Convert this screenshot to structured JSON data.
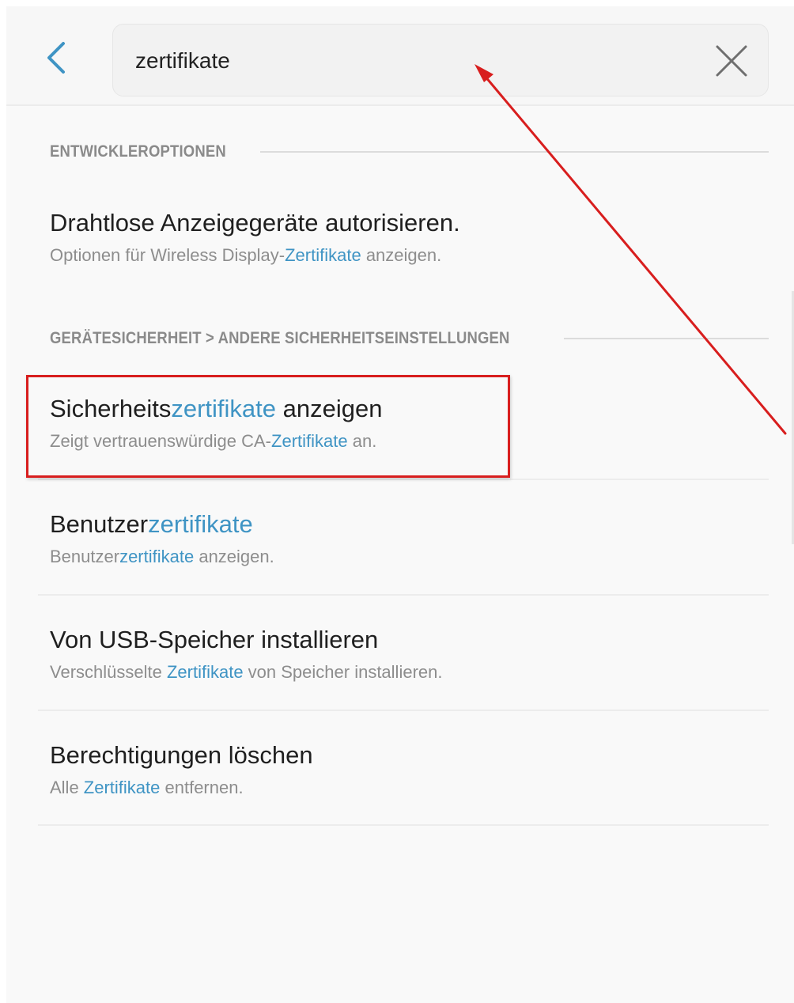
{
  "search": {
    "query": "zertifikate"
  },
  "sections": [
    {
      "header": "ENTWICKLEROPTIONEN",
      "items": [
        {
          "title": [
            "Drahtlose Anzeigegeräte autorisieren."
          ],
          "subtitle": [
            "Optionen für Wireless Display-",
            "Zertifikate",
            " anzeigen."
          ]
        }
      ]
    },
    {
      "header": "GERÄTESICHERHEIT > ANDERE SICHERHEITSEINSTELLUNGEN",
      "items": [
        {
          "title": [
            "Sicherheits",
            "zertifikate",
            " anzeigen"
          ],
          "subtitle": [
            "Zeigt vertrauenswürdige CA-",
            "Zertifikate",
            " an."
          ]
        },
        {
          "title": [
            "Benutzer",
            "zertifikate"
          ],
          "subtitle": [
            "Benutzer",
            "zertifikate",
            " anzeigen."
          ]
        },
        {
          "title": [
            "Von USB-Speicher installieren"
          ],
          "subtitle": [
            "Verschlüsselte ",
            "Zertifikate",
            " von Speicher installieren."
          ]
        },
        {
          "title": [
            "Berechtigungen löschen"
          ],
          "subtitle": [
            "Alle ",
            "Zertifikate",
            " entfernen."
          ]
        }
      ]
    }
  ],
  "icons": {
    "back": "chevron-left-icon",
    "clear": "close-icon"
  },
  "colors": {
    "accent": "#3f94c4",
    "annotation": "#d81e1e",
    "title_text": "#1f1f1f",
    "subtitle_text": "#8d8d8d",
    "section_header_text": "#8a8a8a",
    "background": "#f9f9f9"
  }
}
